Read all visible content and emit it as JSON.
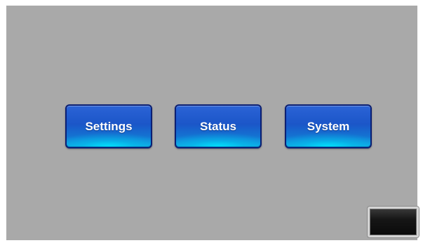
{
  "main_menu": {
    "buttons": [
      {
        "label": "Settings"
      },
      {
        "label": "Status"
      },
      {
        "label": "System"
      }
    ]
  },
  "colors": {
    "screen_background": "#a9a9a9",
    "button_blue": "#1b56c8",
    "button_glow": "#00e6ff",
    "button_border": "#0b1f73",
    "corner_button": "#111111"
  },
  "icons": {
    "corner_button": "dark-square-button"
  }
}
